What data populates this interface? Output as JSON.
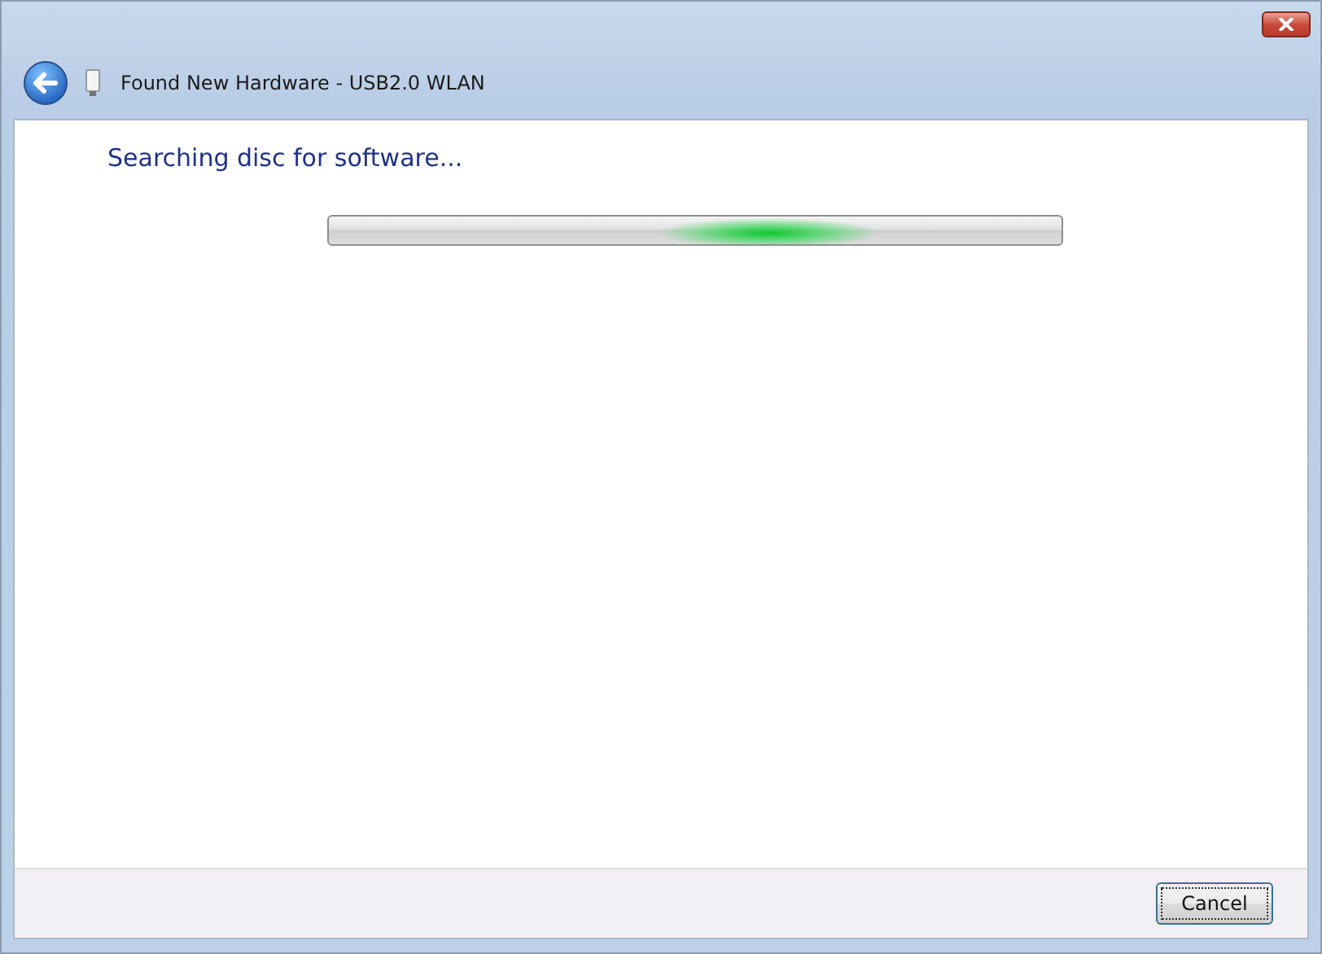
{
  "window": {
    "title": "Found New Hardware - USB2.0 WLAN"
  },
  "heading": "Searching disc for software...",
  "progress": {
    "kind": "marquee",
    "level": 0.6
  },
  "buttons": [
    {
      "label": "Cancel",
      "focused": true
    }
  ]
}
